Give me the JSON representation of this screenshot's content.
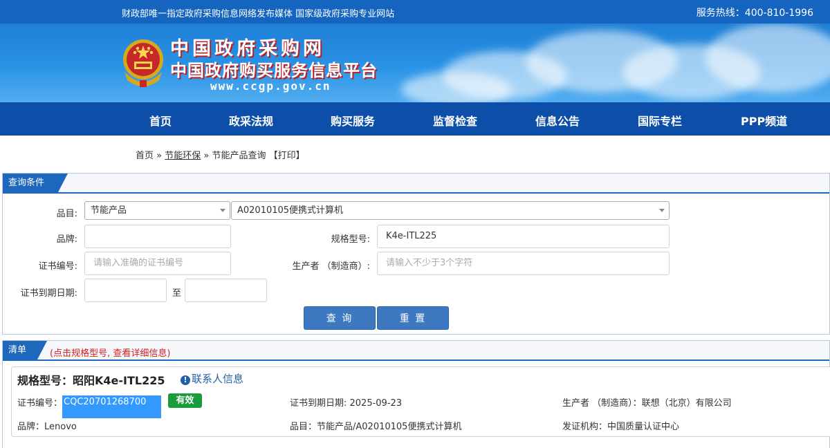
{
  "topbar": {
    "slogan": "财政部唯一指定政府采购信息网络发布媒体 国家级政府采购专业网站",
    "hotline": "服务热线：400-810-1996"
  },
  "brand": {
    "title": "中国政府采购网",
    "subtitle": "中国政府购买服务信息平台",
    "url": "www.ccgp.gov.cn"
  },
  "nav": [
    "首页",
    "政采法规",
    "购买服务",
    "监督检查",
    "信息公告",
    "国际专栏",
    "PPP频道"
  ],
  "breadcrumb": {
    "home": "首页",
    "sep1": " » ",
    "section": "节能环保",
    "sep2": " » ",
    "current": "节能产品查询",
    "print": " 【打印】"
  },
  "query": {
    "tab": "查询条件",
    "category_label": "品目:",
    "category_value": "节能产品",
    "subcategory_value": "A02010105便携式计算机",
    "brand_label": "品牌:",
    "brand_value": "",
    "model_label": "规格型号:",
    "model_value": "K4e-ITL225",
    "cert_label": "证书编号:",
    "cert_placeholder": "请输入准确的证书编号",
    "maker_label": "生产者 （制造商）:",
    "maker_placeholder": "请输入不少于3个字符",
    "expire_label": "证书到期日期:",
    "expire_from": "",
    "to": "至",
    "expire_to": "",
    "search_btn": "查 询",
    "reset_btn": "重 置"
  },
  "results": {
    "tab": "清单",
    "hint": "(点击规格型号, 查看详细信息)",
    "item": {
      "title": "规格型号：昭阳K4e-ITL225",
      "contact": "联系人信息",
      "cert_label": "证书编号：",
      "cert_value": "CQC20701268700",
      "status": "有效",
      "expire": "证书到期日期: 2025-09-23",
      "maker": "生产者 （制造商）：联想（北京）有限公司",
      "brand": "品牌：Lenovo",
      "category": "品目：节能产品/A02010105便携式计算机",
      "issuer": "发证机构：中国质量认证中心"
    }
  },
  "colors": {
    "primary": "#1565c0",
    "nav": "#0d4fa8",
    "button": "#3d78c0",
    "badge": "#1a9b3c",
    "hint": "#d62020"
  }
}
